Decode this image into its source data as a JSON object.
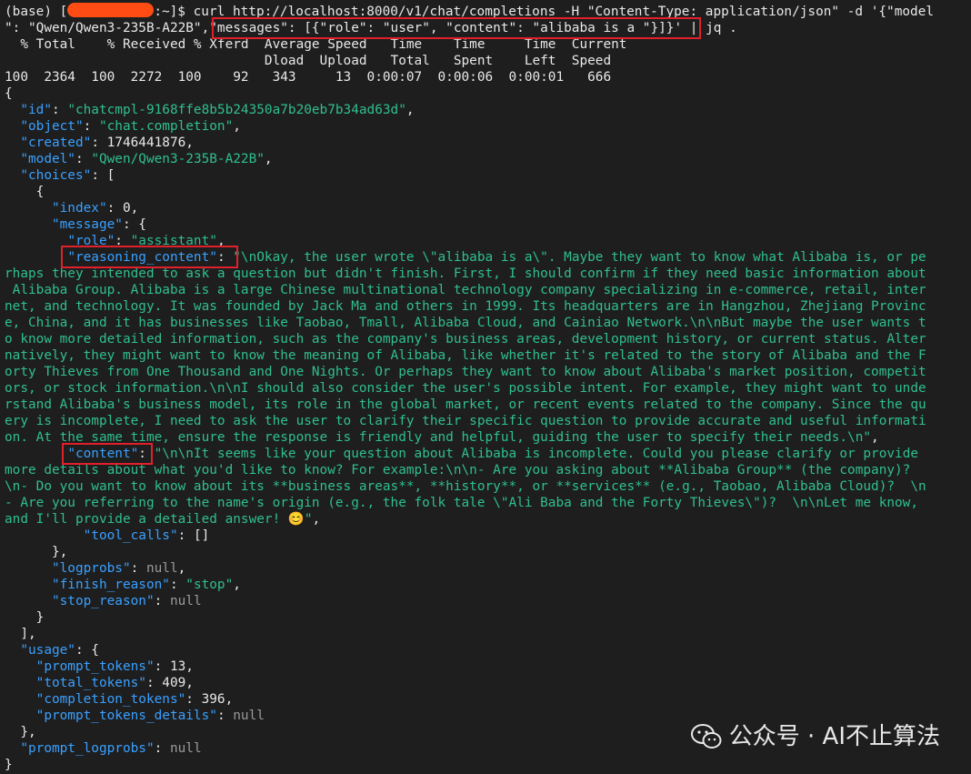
{
  "terminal": {
    "cmd1": "(base) [",
    "cmd2": ":~]$ curl http://localhost:8000/v1/chat/completions -H \"Content-Type: application/json\" -d '{\"model",
    "cmd3a": "\": \"Qwen/Qwen3-235B-A22B\",",
    "cmd3b": "\"messages\": [{\"role\": \"user\", \"content\": \"alibaba is a \"}]}",
    "cmd3c": "' | jq .",
    "prog1": "  % Total    % Received % Xferd  Average Speed   Time    Time     Time  Current",
    "prog2": "                                 Dload  Upload   Total   Spent    Left  Speed",
    "prog3": "100  2364  100  2272  100    92   343     13  0:00:07  0:00:06  0:00:01   666",
    "brace_open": "{",
    "id_key": "\"id\"",
    "id_val": "\"chatcmpl-9168ffe8b5b24350a7b20eb7b34ad63d\"",
    "object_key": "\"object\"",
    "object_val": "\"chat.completion\"",
    "created_key": "\"created\"",
    "created_val": "1746441876",
    "model_key": "\"model\"",
    "model_val": "\"Qwen/Qwen3-235B-A22B\"",
    "choices_key": "\"choices\"",
    "index_key": "\"index\"",
    "index_val": "0",
    "message_key": "\"message\"",
    "role_key": "\"role\"",
    "role_val": "\"assistant\"",
    "reasoning_key": "\"reasoning_content\"",
    "reasoning_lines": [
      "\"\\nOkay, the user wrote \\\"alibaba is a\\\". Maybe they want to know what Alibaba is, or pe",
      "rhaps they intended to ask a question but didn't finish. First, I should confirm if they need basic information about",
      " Alibaba Group. Alibaba is a large Chinese multinational technology company specializing in e-commerce, retail, inter",
      "net, and technology. It was founded by Jack Ma and others in 1999. Its headquarters are in Hangzhou, Zhejiang Provinc",
      "e, China, and it has businesses like Taobao, Tmall, Alibaba Cloud, and Cainiao Network.\\n\\nBut maybe the user wants t",
      "o know more detailed information, such as the company's business areas, development history, or current status. Alter",
      "natively, they might want to know the meaning of Alibaba, like whether it's related to the story of Alibaba and the F",
      "orty Thieves from One Thousand and One Nights. Or perhaps they want to know about Alibaba's market position, competit",
      "ors, or stock information.\\n\\nI should also consider the user's possible intent. For example, they might want to unde",
      "rstand Alibaba's business model, its role in the global market, or recent events related to the company. Since the qu",
      "ery is incomplete, I need to ask the user to clarify their specific question to provide accurate and useful informati",
      "on. At the same time, ensure the response is friendly and helpful, guiding the user to specify their needs.\\n\""
    ],
    "content_key": "\"content\"",
    "content_lines": [
      "\"\\n\\nIt seems like your question about Alibaba is incomplete. Could you please clarify or provide",
      "more details about what you'd like to know? For example:\\n\\n- Are you asking about **Alibaba Group** (the company)?",
      "\\n- Do you want to know about its **business areas**, **history**, or **services** (e.g., Taobao, Alibaba Cloud)?  \\n",
      "- Are you referring to the name's origin (e.g., the folk tale \\\"Ali Baba and the Forty Thieves\\\")?  \\n\\nLet me know,",
      "and I'll provide a detailed answer! 😊\""
    ],
    "tool_calls_key": "\"tool_calls\"",
    "tool_calls_val": "[]",
    "logprobs_key": "\"logprobs\"",
    "logprobs_val": "null",
    "finish_key": "\"finish_reason\"",
    "finish_val": "\"stop\"",
    "stop_key": "\"stop_reason\"",
    "stop_val": "null",
    "usage_key": "\"usage\"",
    "prompt_tokens_key": "\"prompt_tokens\"",
    "prompt_tokens_val": "13",
    "total_tokens_key": "\"total_tokens\"",
    "total_tokens_val": "409",
    "completion_tokens_key": "\"completion_tokens\"",
    "completion_tokens_val": "396",
    "prompt_details_key": "\"prompt_tokens_details\"",
    "prompt_details_val": "null",
    "prompt_logprobs_key": "\"prompt_logprobs\"",
    "prompt_logprobs_val": "null",
    "brace_close": "}"
  },
  "watermark": {
    "text": "公众号 · AI不止算法",
    "icon": "wechat-icon"
  },
  "colors": {
    "background": "#1e1e1e",
    "key": "#3aa0ff",
    "string": "#2fbf8f",
    "highlight": "#e0202a",
    "redaction": "#ff4c14"
  }
}
